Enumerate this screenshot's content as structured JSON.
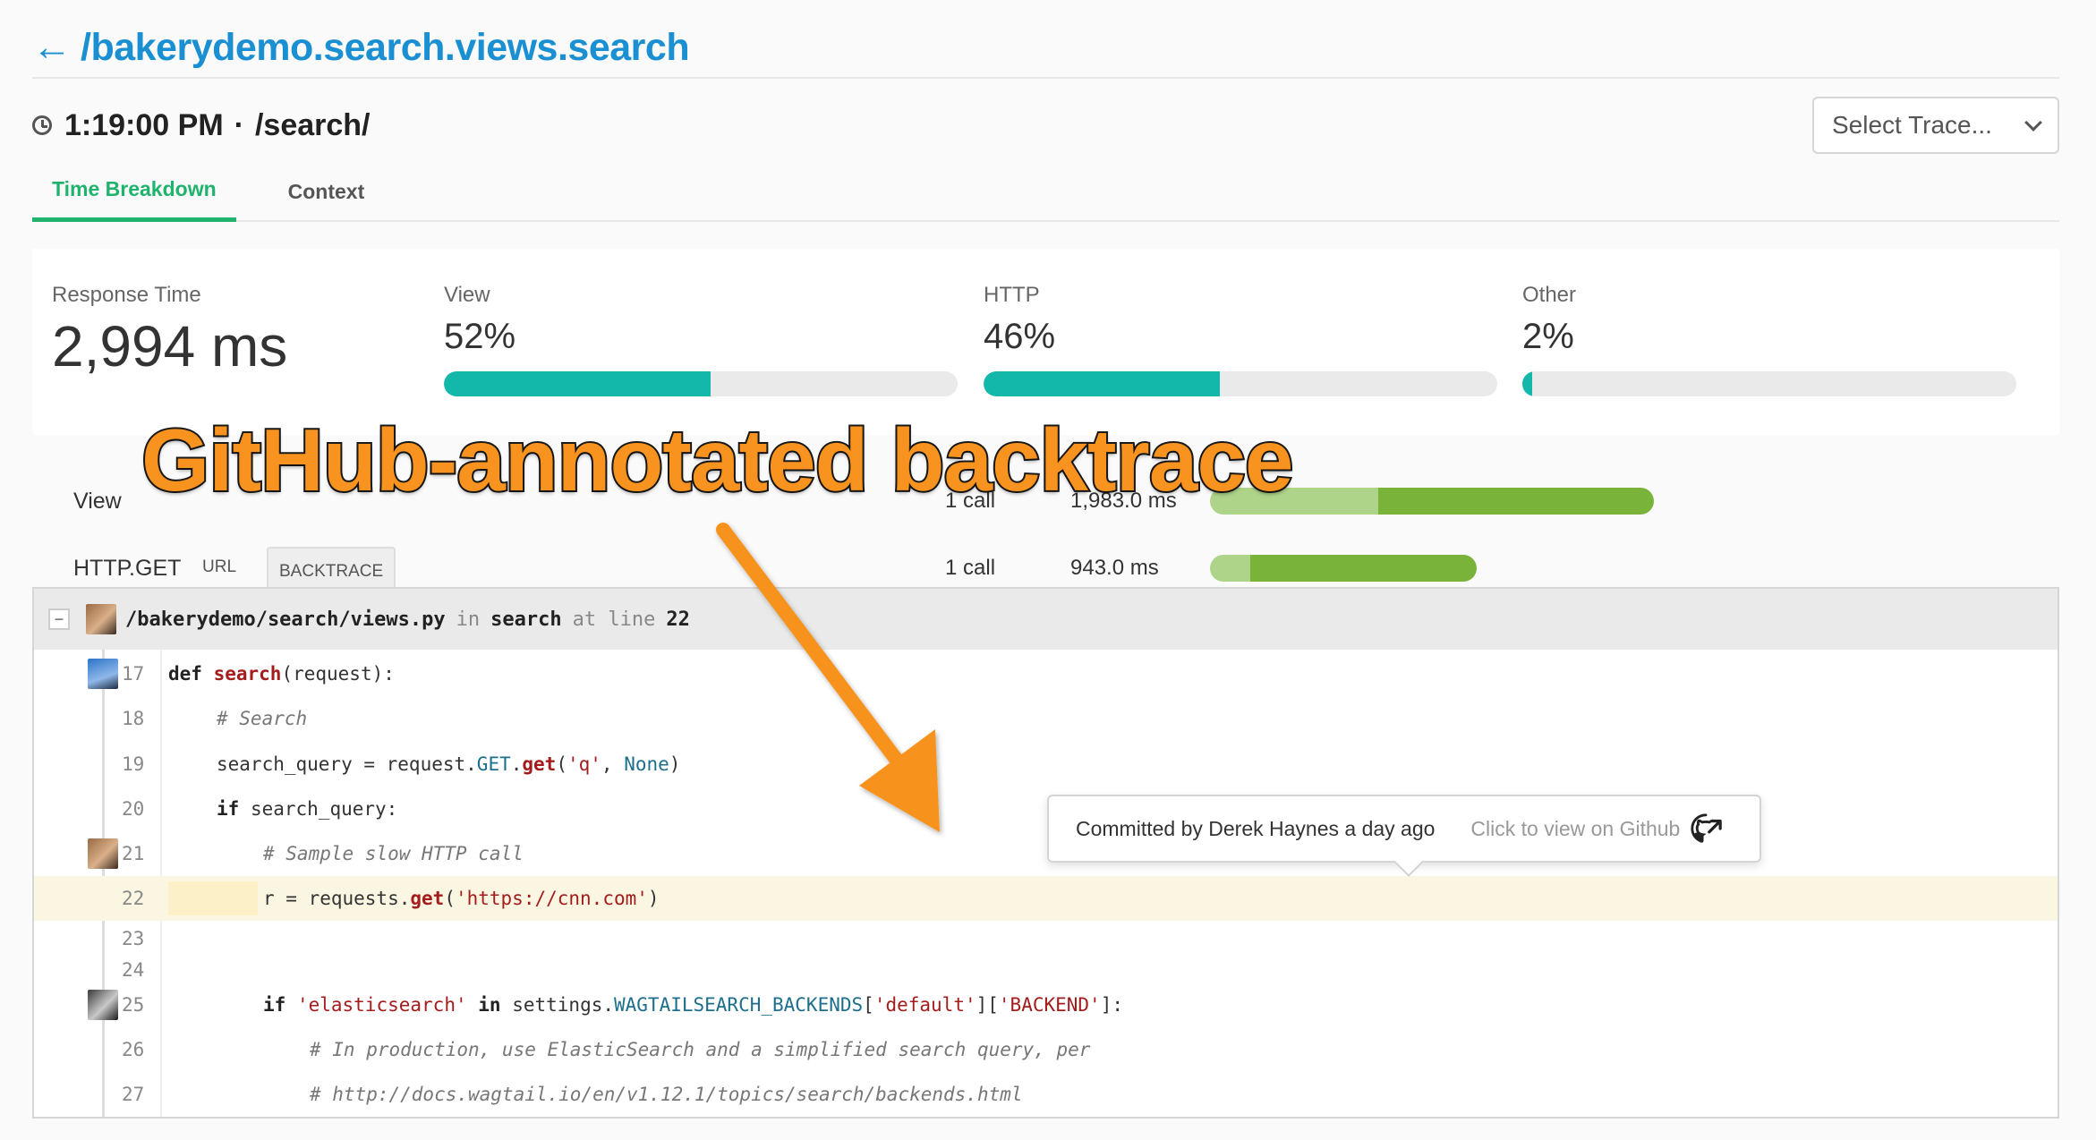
{
  "header": {
    "back_icon": "arrow-left-icon",
    "title": "/bakerydemo.search.views.search"
  },
  "trace": {
    "time": "1:19:00 PM",
    "separator": "·",
    "path": "/search/",
    "select_label": "Select Trace..."
  },
  "tabs": [
    {
      "label": "Time Breakdown",
      "active": true
    },
    {
      "label": "Context",
      "active": false
    }
  ],
  "summary": {
    "response_time": {
      "label": "Response Time",
      "value": "2,994 ms"
    },
    "metrics": [
      {
        "label": "View",
        "value": "52%",
        "fraction": 0.52
      },
      {
        "label": "HTTP",
        "value": "46%",
        "fraction": 0.46
      },
      {
        "label": "Other",
        "value": "2%",
        "fraction": 0.02
      }
    ]
  },
  "breakdown": {
    "view": {
      "label": "View",
      "calls": "1 call",
      "duration": "1,983.0 ms",
      "light_fraction": 0.38,
      "total_fraction": 1.0
    },
    "http": {
      "label": "HTTP.GET",
      "calls": "1 call",
      "duration": "943.0 ms",
      "url_tab": "URL",
      "backtrace_tab": "BACKTRACE",
      "light_fraction": 0.15,
      "total_fraction": 0.6
    }
  },
  "backtrace": {
    "file": "/bakerydemo/search/views.py",
    "in_kw": "in",
    "function": "search",
    "at_kw": "at line",
    "line": "22",
    "collapse": "−"
  },
  "code": [
    {
      "n": "17",
      "avatar": "av-b"
    },
    {
      "n": "18"
    },
    {
      "n": "19"
    },
    {
      "n": "20"
    },
    {
      "n": "21",
      "avatar": "av-a"
    },
    {
      "n": "22",
      "highlight": true
    },
    {
      "n": "23"
    },
    {
      "n": "24"
    },
    {
      "n": "25",
      "avatar": "av-c"
    },
    {
      "n": "26"
    },
    {
      "n": "27"
    }
  ],
  "code_tokens": {
    "l17": [
      "def",
      " ",
      "search",
      "(request):"
    ],
    "l18": "# Search",
    "l19": [
      "search_query = request.",
      "GET",
      ".",
      "get",
      "(",
      "'q'",
      ", ",
      "None",
      ")"
    ],
    "l20": [
      "if",
      " search_query:"
    ],
    "l21": "# Sample slow HTTP call",
    "l22": [
      "r = requests.",
      "get",
      "(",
      "'https://cnn.com'",
      ")"
    ],
    "l25": [
      "if",
      " ",
      "'elasticsearch'",
      " ",
      "in",
      " settings.",
      "WAGTAILSEARCH_BACKENDS",
      "[",
      "'default'",
      "][",
      "'BACKEND'",
      "]:"
    ],
    "l26": "# In production, use ElasticSearch and a simplified search query, per",
    "l27": "# http://docs.wagtail.io/en/v1.12.1/topics/search/backends.html"
  },
  "tooltip": {
    "commit": "Committed by Derek Haynes a day ago",
    "link": "Click to view on Github",
    "icon": "github-icon"
  },
  "annotation": {
    "text": "GitHub-annotated backtrace"
  },
  "colors": {
    "accent_blue": "#1a8fd1",
    "tab_green": "#1fb36d",
    "teal": "#14b8aa",
    "bar_green": "#7ab339",
    "annotation_orange": "#f7931e"
  }
}
